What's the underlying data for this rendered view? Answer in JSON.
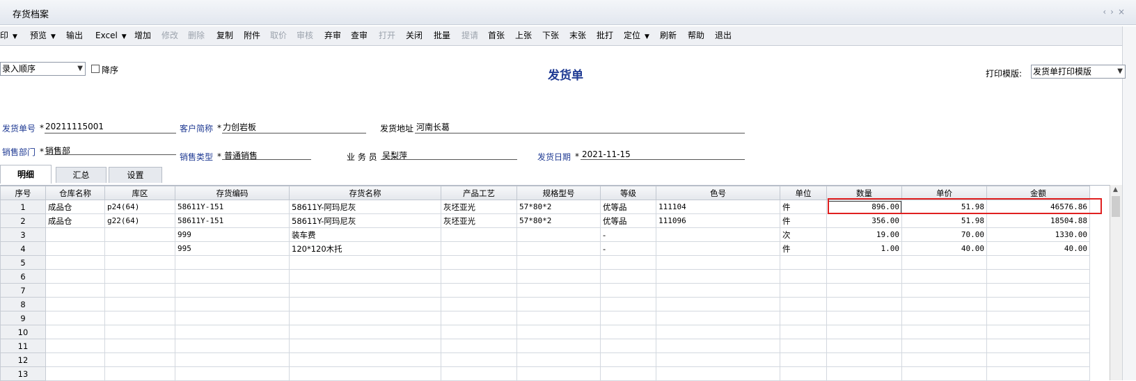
{
  "window": {
    "title": "存货档案",
    "nav_prev": "‹",
    "nav_next": "›",
    "nav_close": "×"
  },
  "toolbar": {
    "buttons": [
      {
        "label": "印",
        "dropdown": true,
        "enabled": true
      },
      {
        "label": "预览",
        "dropdown": true,
        "enabled": true
      },
      {
        "label": "输出",
        "dropdown": false,
        "enabled": true
      },
      {
        "label": "Excel",
        "dropdown": true,
        "enabled": true
      },
      {
        "label": "增加",
        "dropdown": false,
        "enabled": true
      },
      {
        "label": "修改",
        "dropdown": false,
        "enabled": false
      },
      {
        "label": "删除",
        "dropdown": false,
        "enabled": false
      },
      {
        "label": "复制",
        "dropdown": false,
        "enabled": true
      },
      {
        "label": "附件",
        "dropdown": false,
        "enabled": true
      },
      {
        "label": "取价",
        "dropdown": false,
        "enabled": false
      },
      {
        "label": "审核",
        "dropdown": false,
        "enabled": false
      },
      {
        "label": "弃审",
        "dropdown": false,
        "enabled": true
      },
      {
        "label": "查审",
        "dropdown": false,
        "enabled": true
      },
      {
        "label": "打开",
        "dropdown": false,
        "enabled": false
      },
      {
        "label": "关闭",
        "dropdown": false,
        "enabled": true
      },
      {
        "label": "批量",
        "dropdown": false,
        "enabled": true
      },
      {
        "label": "提请",
        "dropdown": false,
        "enabled": false
      },
      {
        "label": "首张",
        "dropdown": false,
        "enabled": true
      },
      {
        "label": "上张",
        "dropdown": false,
        "enabled": true
      },
      {
        "label": "下张",
        "dropdown": false,
        "enabled": true
      },
      {
        "label": "末张",
        "dropdown": false,
        "enabled": true
      },
      {
        "label": "批打",
        "dropdown": false,
        "enabled": true
      },
      {
        "label": "定位",
        "dropdown": true,
        "enabled": true
      },
      {
        "label": "刷新",
        "dropdown": false,
        "enabled": true
      },
      {
        "label": "帮助",
        "dropdown": false,
        "enabled": true
      },
      {
        "label": "退出",
        "dropdown": false,
        "enabled": true
      }
    ]
  },
  "sort": {
    "selected": "录入顺序",
    "desc_label": "降序",
    "desc_checked": false
  },
  "form_title": "发货单",
  "print_template": {
    "label": "打印模版:",
    "selected": "发货单打印模版"
  },
  "header": {
    "order_no": {
      "label": "发货单号",
      "value": "20211115001"
    },
    "customer": {
      "label": "客户简称",
      "value": "力创岩板"
    },
    "address": {
      "label": "发货地址",
      "value": "河南长葛"
    },
    "dept": {
      "label": "销售部门",
      "value": "销售部"
    },
    "sale_type": {
      "label": "销售类型",
      "value": "普通销售"
    },
    "salesman": {
      "label": "业 务 员",
      "value": "吴梨萍"
    },
    "ship_date": {
      "label": "发货日期",
      "value": "2021-11-15"
    },
    "required_mark": "*"
  },
  "tabs": [
    "明细",
    "汇总",
    "设置"
  ],
  "grid": {
    "columns": [
      "序号",
      "仓库名称",
      "库区",
      "存货编码",
      "存货名称",
      "产品工艺",
      "规格型号",
      "等级",
      "色号",
      "单位",
      "数量",
      "单价",
      "金额"
    ],
    "rows": [
      [
        "1",
        "成品仓",
        "p24(64)",
        "58611Y-151",
        "58611Y-阿玛尼灰",
        "灰坯亚光",
        "57*80*2",
        "优等品",
        "111104",
        "件",
        "896.00",
        "51.98",
        "46576.86"
      ],
      [
        "2",
        "成品仓",
        "g22(64)",
        "58611Y-151",
        "58611Y-阿玛尼灰",
        "灰坯亚光",
        "57*80*2",
        "优等品",
        "111096",
        "件",
        "356.00",
        "51.98",
        "18504.88"
      ],
      [
        "3",
        "",
        "",
        "999",
        "装车费",
        "",
        "",
        "-",
        "",
        "次",
        "19.00",
        "70.00",
        "1330.00"
      ],
      [
        "4",
        "",
        "",
        "995",
        "120*120木托",
        "",
        "",
        "-",
        "",
        "件",
        "1.00",
        "40.00",
        "40.00"
      ],
      [
        "5",
        "",
        "",
        "",
        "",
        "",
        "",
        "",
        "",
        "",
        "",
        "",
        ""
      ],
      [
        "6",
        "",
        "",
        "",
        "",
        "",
        "",
        "",
        "",
        "",
        "",
        "",
        ""
      ],
      [
        "7",
        "",
        "",
        "",
        "",
        "",
        "",
        "",
        "",
        "",
        "",
        "",
        ""
      ],
      [
        "8",
        "",
        "",
        "",
        "",
        "",
        "",
        "",
        "",
        "",
        "",
        "",
        ""
      ],
      [
        "9",
        "",
        "",
        "",
        "",
        "",
        "",
        "",
        "",
        "",
        "",
        "",
        ""
      ],
      [
        "10",
        "",
        "",
        "",
        "",
        "",
        "",
        "",
        "",
        "",
        "",
        "",
        ""
      ],
      [
        "11",
        "",
        "",
        "",
        "",
        "",
        "",
        "",
        "",
        "",
        "",
        "",
        ""
      ],
      [
        "12",
        "",
        "",
        "",
        "",
        "",
        "",
        "",
        "",
        "",
        "",
        "",
        ""
      ],
      [
        "13",
        "",
        "",
        "",
        "",
        "",
        "",
        "",
        "",
        "",
        "",
        "",
        ""
      ]
    ]
  },
  "colors": {
    "label_blue": "#1f3a93",
    "highlight_red": "#e02020"
  }
}
